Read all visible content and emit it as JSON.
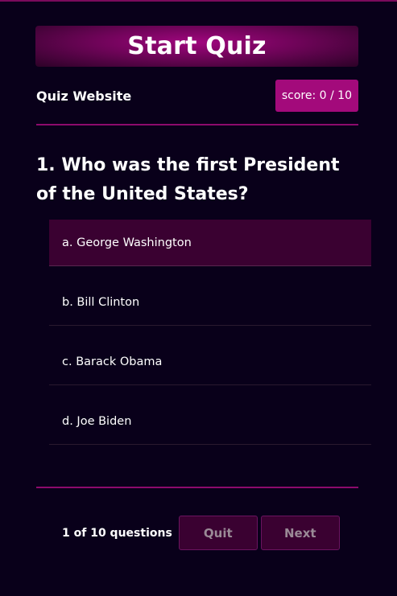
{
  "banner": {
    "title": "Start Quiz"
  },
  "header": {
    "site_name": "Quiz Website",
    "score": "score: 0 / 10"
  },
  "question": {
    "text": "1. Who was the first President of the United States?"
  },
  "options": [
    {
      "label": "a. George Washington",
      "selected": true
    },
    {
      "label": "b. Bill Clinton",
      "selected": false
    },
    {
      "label": "c. Barack Obama",
      "selected": false
    },
    {
      "label": "d. Joe Biden",
      "selected": false
    }
  ],
  "footer": {
    "progress": "1 of 10 questions",
    "quit_label": "Quit",
    "next_label": "Next"
  },
  "colors": {
    "background": "#09001a",
    "accent": "#a30a7b",
    "selected_option": "#3a0131"
  }
}
